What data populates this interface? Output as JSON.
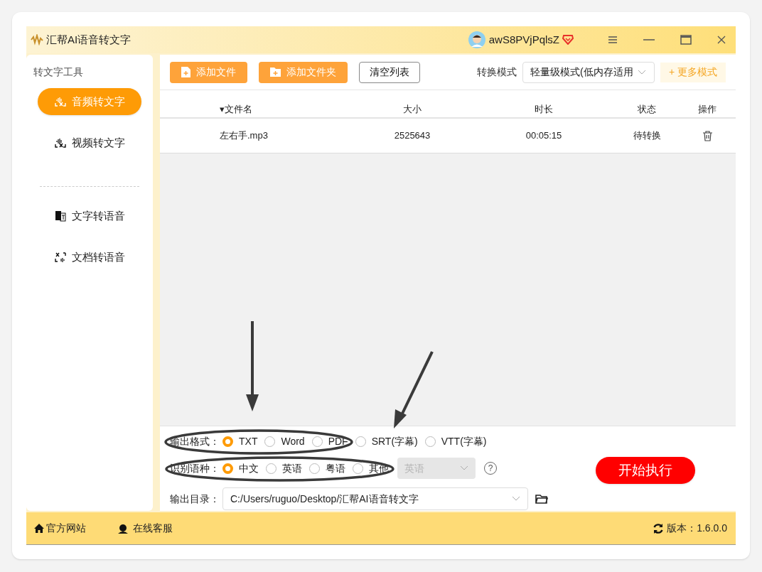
{
  "window": {
    "title": "汇帮AI语音转文字",
    "username": "awS8PVjPqlsZ"
  },
  "sidebar": {
    "heading": "转文字工具",
    "items": [
      {
        "label": "音频转文字",
        "selected": true,
        "kind": "audio"
      },
      {
        "label": "视频转文字",
        "selected": false,
        "kind": "video"
      },
      {
        "label": "文字转语音",
        "selected": false,
        "kind": "text"
      },
      {
        "label": "文档转语音",
        "selected": false,
        "kind": "doc"
      }
    ]
  },
  "toolbar": {
    "buttons": [
      "添加文件",
      "添加文件夹",
      "清空列表"
    ],
    "mode_label": "转换模式",
    "mode_value": "轻量级模式(低内存适用",
    "more_button": "+ 更多模式"
  },
  "table": {
    "columns": [
      "▾文件名",
      "大小",
      "时长",
      "状态",
      "操作"
    ],
    "rows": [
      {
        "name": "左右手.mp3",
        "size": "2525643",
        "duration": "00:05:15",
        "status": "待转换"
      }
    ]
  },
  "options": {
    "format_label": "输出格式：",
    "formats": [
      {
        "label": "TXT",
        "selected": true
      },
      {
        "label": "Word",
        "selected": false
      },
      {
        "label": "PDF",
        "selected": false
      },
      {
        "label": "SRT(字幕)",
        "selected": false
      },
      {
        "label": "VTT(字幕)",
        "selected": false
      }
    ],
    "language_label": "识别语种：",
    "languages": [
      {
        "label": "中文",
        "selected": true
      },
      {
        "label": "英语",
        "selected": false
      },
      {
        "label": "粤语",
        "selected": false
      },
      {
        "label": "其他",
        "selected": false
      }
    ],
    "other_language": {
      "value": "英语",
      "disabled": true
    },
    "help": "?",
    "output_label": "输出目录：",
    "output_path": "C:/Users/ruguo/Desktop/汇帮AI语音转文字",
    "start_button": "开始执行"
  },
  "status_bar": {
    "website": "官方网站",
    "support": "在线客服",
    "version": "版本：1.6.0.0"
  }
}
